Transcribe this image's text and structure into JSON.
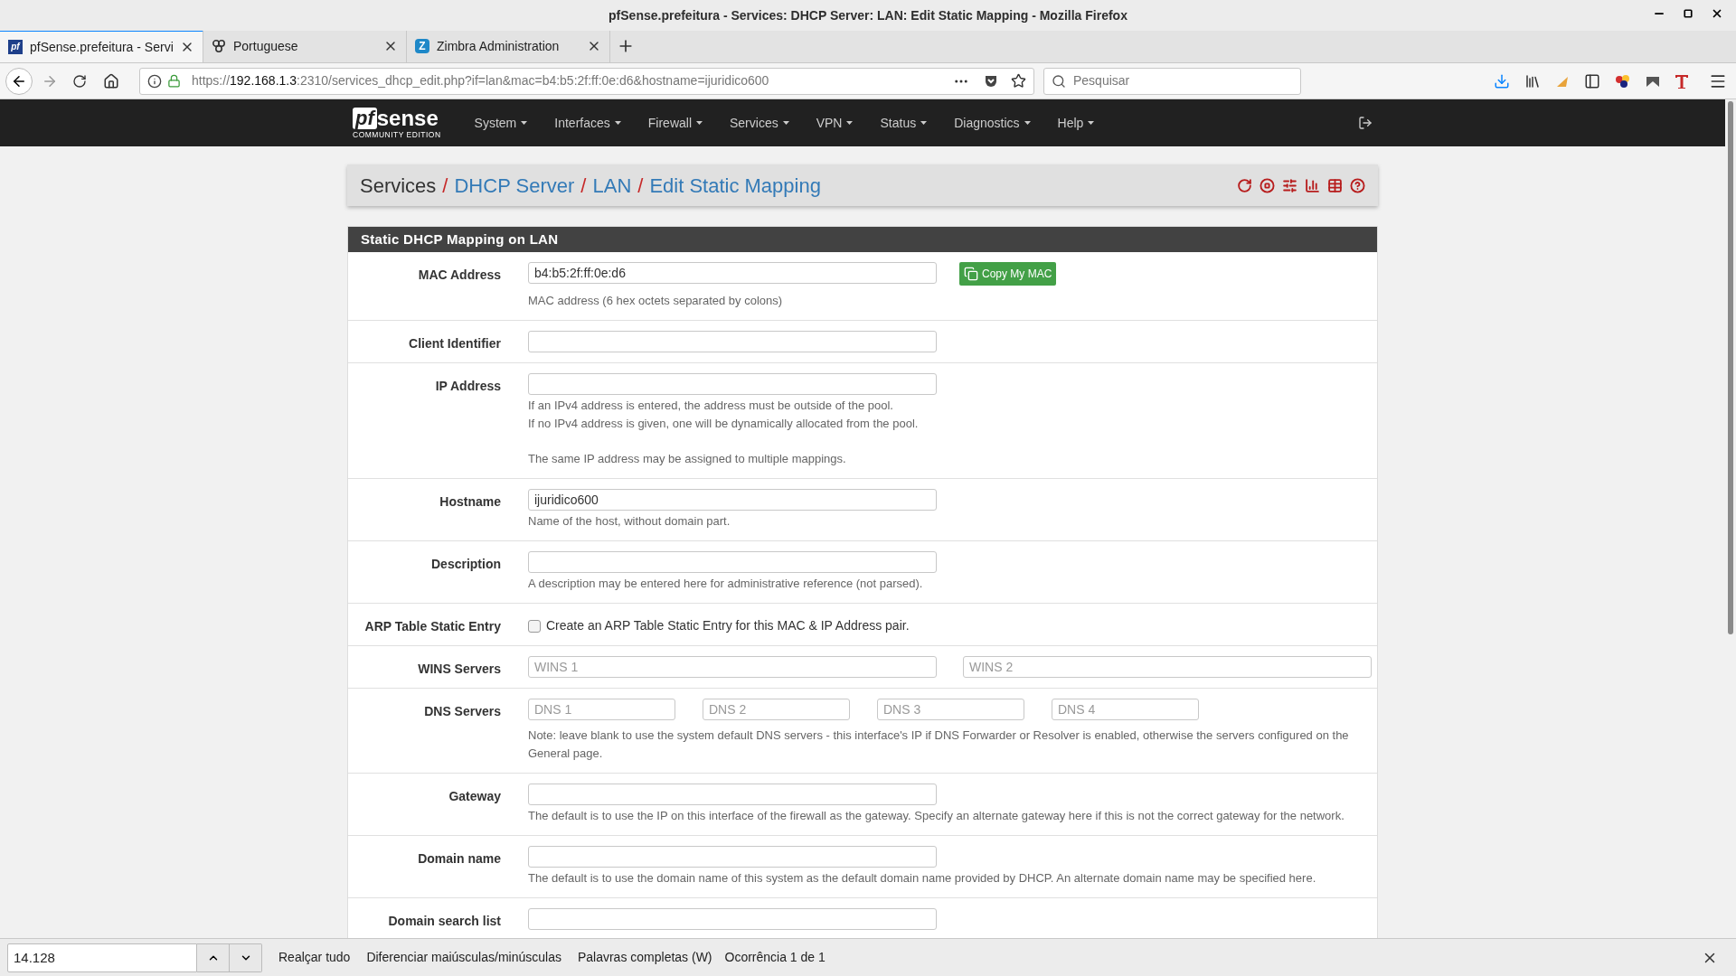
{
  "window": {
    "title": "pfSense.prefeitura - Services: DHCP Server: LAN: Edit Static Mapping - Mozilla Firefox"
  },
  "tabs": [
    {
      "title": "pfSense.prefeitura - Servi",
      "selected": true,
      "kind": "pf",
      "icon_text": "pf"
    },
    {
      "title": "Portuguese",
      "selected": false,
      "kind": "rings"
    },
    {
      "title": "Zimbra Administration",
      "selected": false,
      "kind": "z",
      "icon_text": "Z"
    }
  ],
  "address_bar": {
    "scheme": "https://",
    "host": "192.168.1.3",
    "rest": ":2310/services_dhcp_edit.php?if=lan&mac=b4:b5:2f:ff:0e:d6&hostname=ijuridico600"
  },
  "search": {
    "placeholder": "Pesquisar"
  },
  "logo": {
    "mark": "pf",
    "name": "sense",
    "tagline": "COMMUNITY EDITION"
  },
  "menu": [
    "System",
    "Interfaces",
    "Firewall",
    "Services",
    "VPN",
    "Status",
    "Diagnostics",
    "Help"
  ],
  "breadcrumb": {
    "separator": "/",
    "items": [
      {
        "label": "Services",
        "link": false
      },
      {
        "label": "DHCP Server",
        "link": true
      },
      {
        "label": "LAN",
        "link": true
      },
      {
        "label": "Edit Static Mapping",
        "link": true
      }
    ]
  },
  "panel": {
    "title": "Static DHCP Mapping on LAN"
  },
  "rows": [
    {
      "kind": "input",
      "label": "MAC Address",
      "value": "b4:b5:2f:ff:0e:d6",
      "button": "Copy My MAC",
      "help": [
        [
          "MAC address (6 hex octets separated by colons)"
        ]
      ]
    },
    {
      "kind": "input",
      "label": "Client Identifier"
    },
    {
      "kind": "input",
      "label": "IP Address",
      "help": [
        [
          "If an IPv4 address is entered, the address must be outside of the pool.",
          "If no IPv4 address is given, one will be dynamically allocated from the pool."
        ],
        [
          "The same IP address may be assigned to multiple mappings."
        ]
      ]
    },
    {
      "kind": "input",
      "label": "Hostname",
      "value": "ijuridico600",
      "help": [
        [
          "Name of the host, without domain part."
        ]
      ]
    },
    {
      "kind": "input",
      "label": "Description",
      "help": [
        [
          "A description may be entered here for administrative reference (not parsed)."
        ]
      ]
    },
    {
      "kind": "checkbox",
      "label": "ARP Table Static Entry",
      "checked": false,
      "text": "Create an ARP Table Static Entry for this MAC & IP Address pair."
    },
    {
      "kind": "multi",
      "label": "WINS Servers",
      "fields": [
        {
          "placeholder": "WINS 1"
        },
        {
          "placeholder": "WINS 2"
        }
      ]
    },
    {
      "kind": "multi",
      "label": "DNS Servers",
      "fields": [
        {
          "placeholder": "DNS 1"
        },
        {
          "placeholder": "DNS 2"
        },
        {
          "placeholder": "DNS 3"
        },
        {
          "placeholder": "DNS 4"
        }
      ],
      "help": [
        [
          "Note: leave blank to use the system default DNS servers - this interface's IP if DNS Forwarder or Resolver is enabled, otherwise the servers configured on the General page."
        ]
      ]
    },
    {
      "kind": "input",
      "label": "Gateway",
      "help": [
        [
          "The default is to use the IP on this interface of the firewall as the gateway. Specify an alternate gateway here if this is not the correct gateway for the network."
        ]
      ]
    },
    {
      "kind": "input",
      "label": "Domain name",
      "help": [
        [
          "The default is to use the domain name of this system as the default domain name provided by DHCP. An alternate domain name may be specified here."
        ]
      ]
    },
    {
      "kind": "input",
      "label": "Domain search list"
    }
  ],
  "find_bar": {
    "value": "14.128",
    "options": [
      "Realçar tudo",
      "Diferenciar maiúsculas/minúsculas",
      "Palavras completas (W)"
    ],
    "status": "Ocorrência 1 de 1"
  }
}
